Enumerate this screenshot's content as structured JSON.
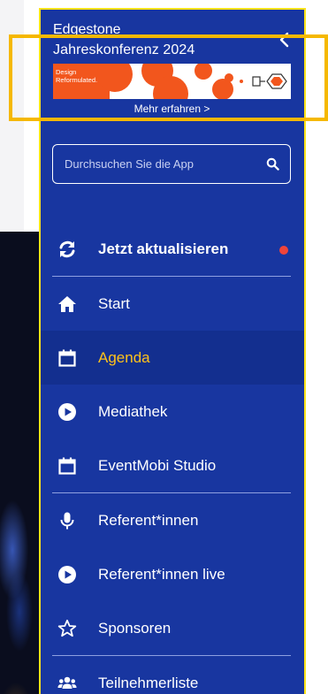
{
  "drawer": {
    "org_name": "Edgestone",
    "conference_title": "Jahreskonferenz 2024",
    "banner": {
      "tagline": "Design Reformulated.",
      "link_label": "Mehr erfahren >"
    },
    "search": {
      "placeholder": "Durchsuchen Sie die App"
    },
    "menu": [
      {
        "label": "Jetzt aktualisieren",
        "icon": "refresh-icon",
        "bold": true,
        "notification_dot": true
      },
      {
        "label": "Start",
        "icon": "home-icon"
      },
      {
        "label": "Agenda",
        "icon": "calendar-icon",
        "active": true
      },
      {
        "label": "Mediathek",
        "icon": "play-circle-icon"
      },
      {
        "label": "EventMobi Studio",
        "icon": "calendar-icon"
      },
      {
        "label": "Referent*innen",
        "icon": "microphone-icon"
      },
      {
        "label": "Referent*innen live",
        "icon": "play-circle-icon"
      },
      {
        "label": "Sponsoren",
        "icon": "star-outline-icon"
      },
      {
        "label": "Teilnehmerliste",
        "icon": "users-icon"
      }
    ]
  },
  "colors": {
    "drawer_bg": "#1836a0",
    "active_bg": "#132f8f",
    "active_text": "#ffc21a",
    "drawer_border": "#ffe31a",
    "highlight_outline": "#f5b800",
    "banner_orange": "#f2561d",
    "notification_dot": "#f0443a"
  }
}
